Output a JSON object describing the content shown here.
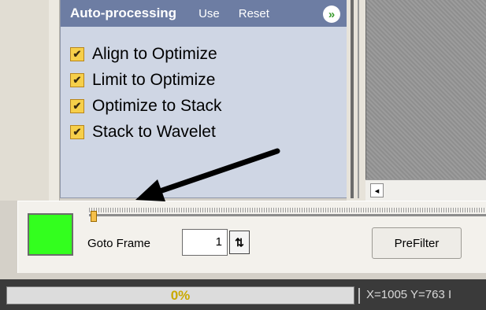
{
  "auto_processing": {
    "title": "Auto-processing",
    "use_label": "Use",
    "reset_label": "Reset",
    "collapse_glyph": "»",
    "items": [
      {
        "label": "Align to Optimize",
        "checked": true
      },
      {
        "label": "Limit to Optimize",
        "checked": true
      },
      {
        "label": "Optimize to Stack",
        "checked": true
      },
      {
        "label": "Stack to Wavelet",
        "checked": true
      }
    ],
    "check_glyph": "✔"
  },
  "scrollbar": {
    "left_arrow": "◂"
  },
  "controls": {
    "color_swatch": "#33ff1e",
    "timeline_position": 0,
    "goto_label": "Goto Frame",
    "goto_value": "1",
    "stepper_glyph": "⇅",
    "prefilter_label": "PreFilter"
  },
  "status": {
    "progress_text": "0%",
    "progress_value": 0,
    "coords_text": "X=1005 Y=763 I"
  },
  "colors": {
    "panel_header": "#6d7da3",
    "checkbox": "#f6cf4a",
    "progress_text": "#c9a900"
  }
}
